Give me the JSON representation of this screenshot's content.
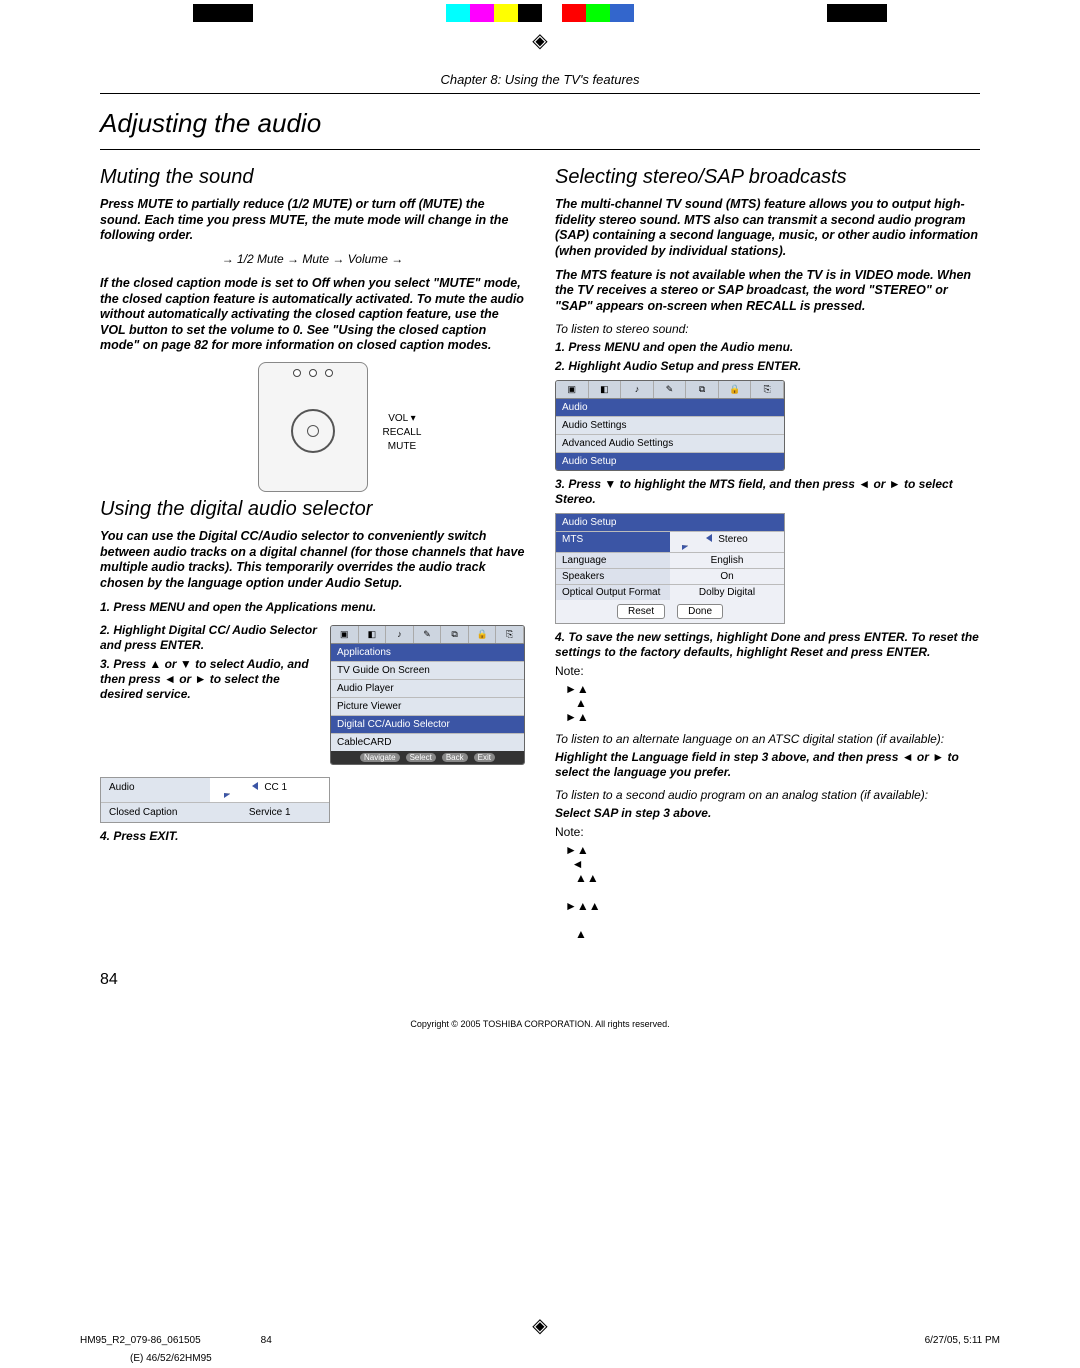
{
  "chapter": "Chapter 8: Using the TV's features",
  "h1": "Adjusting the audio",
  "left": {
    "h2a": "Muting the sound",
    "intro1": "Press MUTE to partially reduce (1/2 MUTE) or turn off (MUTE) the sound. Each time you press MUTE, the mute mode will change in the following order.",
    "chain": "→ 1/2 Mute → Mute → Volume →",
    "intro2": "If the closed caption mode is set to Off when you select \"MUTE\" mode, the closed caption feature is automatically activated. To mute the audio without automatically activating the closed caption feature, use the VOL button to set the volume to 0. See \"Using the closed caption mode\" on page 82 for more information on closed caption modes.",
    "remote_labels": {
      "a": "VOL ▾",
      "b": "RECALL",
      "c": "MUTE"
    },
    "h2b": "Using the digital audio selector",
    "intro3": "You can use the Digital CC/Audio selector to conveniently switch between audio tracks on a digital channel (for those channels that have multiple audio tracks). This temporarily overrides the audio track chosen by the language option under Audio Setup.",
    "step1": "1. Press MENU and open the Applications menu.",
    "step2": "2. Highlight Digital CC/ Audio Selector and press ENTER.",
    "step3": "3. Press ▲ or ▼ to select Audio, and then press ◄ or ► to select the desired service.",
    "step4": "4. Press EXIT.",
    "apps_menu": {
      "head": "Applications",
      "items": [
        "TV Guide On Screen",
        "Audio Player",
        "Picture Viewer",
        "Digital CC/Audio Selector",
        "CableCARD"
      ],
      "footer": [
        "Navigate",
        "Select",
        "Back",
        "Exit"
      ]
    },
    "audio_cc": {
      "r1k": "Audio",
      "r1v": "CC 1",
      "r2k": "Closed Caption",
      "r2v": "Service 1"
    }
  },
  "right": {
    "h2": "Selecting stereo/SAP broadcasts",
    "intro1": "The multi-channel TV sound (MTS) feature allows you to output high-fidelity stereo sound. MTS also can transmit a second audio program (SAP) containing a second language, music, or other audio information (when provided by individual stations).",
    "intro2": "The MTS feature is not available when the TV is in VIDEO mode. When the TV receives a stereo or SAP broadcast, the word \"STEREO\" or \"SAP\" appears on-screen when RECALL is pressed.",
    "note_listen": "To listen to stereo sound:",
    "step1": "1. Press MENU and open the Audio menu.",
    "step2": "2. Highlight Audio Setup and press ENTER.",
    "audio_menu": {
      "head": "Audio",
      "items": [
        "Audio Settings",
        "Advanced Audio Settings",
        "Audio Setup"
      ]
    },
    "step3": "3. Press ▼ to highlight the MTS field, and then press ◄ or ► to select Stereo.",
    "setup_table": {
      "head": "Audio Setup",
      "rows": [
        {
          "k": "MTS",
          "v": "Stereo",
          "sel": true
        },
        {
          "k": "Language",
          "v": "English"
        },
        {
          "k": "Speakers",
          "v": "On"
        },
        {
          "k": "Optical Output Format",
          "v": "Dolby Digital"
        }
      ],
      "btn1": "Reset",
      "btn2": "Done"
    },
    "step4": "4. To save the new settings, highlight Done and press ENTER. To reset the settings to the factory defaults, highlight Reset and press ENTER.",
    "note_label": "Note:",
    "note_alt": "To listen to an alternate language on an ATSC digital station (if available):",
    "step_alt": "Highlight the Language field in step 3 above, and then press ◄ or ► to select the language you prefer.",
    "note_sap": "To listen to a second audio program on an analog station (if available):",
    "step_sap": "Select SAP in step 3 above.",
    "note_label2": "Note:"
  },
  "pgnum": "84",
  "copyright": "Copyright © 2005 TOSHIBA CORPORATION. All rights reserved.",
  "footer": {
    "a": "HM95_R2_079-86_061505",
    "b": "84",
    "c": "6/27/05, 5:11 PM",
    "d": "(E) 46/52/62HM95"
  }
}
